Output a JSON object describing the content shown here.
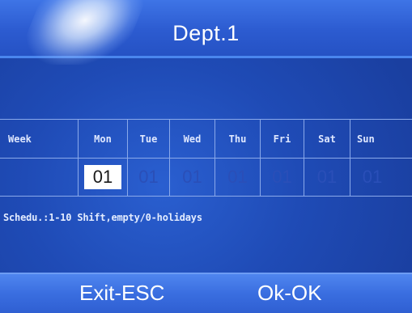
{
  "title": "Dept.1",
  "schedule": {
    "header_label": "Week",
    "days": [
      "Mon",
      "Tue",
      "Wed",
      "Thu",
      "Fri",
      "Sat",
      "Sun"
    ],
    "values": [
      "01",
      "01",
      "01",
      "01",
      "01",
      "01",
      "01"
    ],
    "selected_day": "Mon"
  },
  "hint": "Schedu.:1-10 Shift,empty/0-holidays",
  "footer": {
    "exit_label": "Exit-ESC",
    "ok_label": "Ok-OK"
  },
  "colors": {
    "background": "#1f4bb6",
    "title_bar": "#2c5bd0",
    "footer_bar": "#3a6ee0",
    "grid_lines": "#8aa9ea",
    "selected_cell": "#ffffff",
    "inactive_value": "#2a4fb8"
  }
}
